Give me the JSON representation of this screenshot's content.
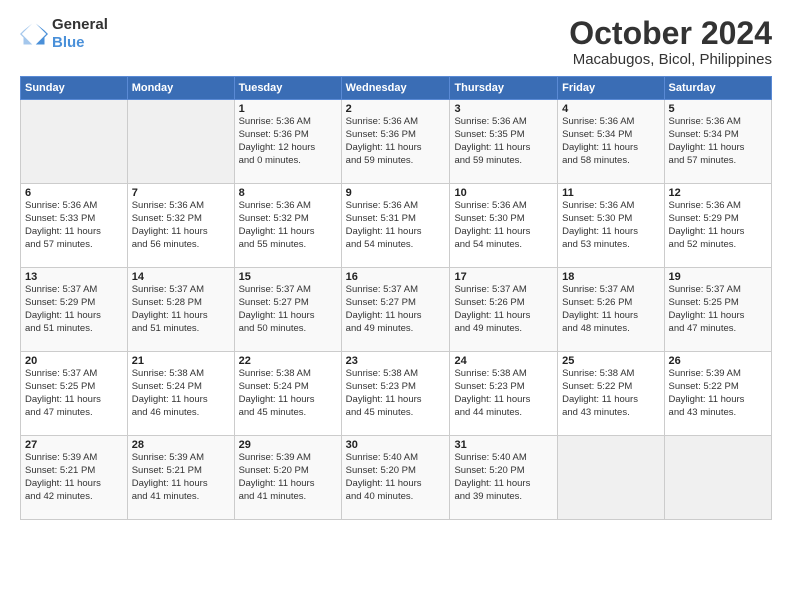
{
  "header": {
    "logo_line1": "General",
    "logo_line2": "Blue",
    "title": "October 2024",
    "subtitle": "Macabugos, Bicol, Philippines"
  },
  "weekdays": [
    "Sunday",
    "Monday",
    "Tuesday",
    "Wednesday",
    "Thursday",
    "Friday",
    "Saturday"
  ],
  "weeks": [
    [
      {
        "day": "",
        "info": ""
      },
      {
        "day": "",
        "info": ""
      },
      {
        "day": "1",
        "info": "Sunrise: 5:36 AM\nSunset: 5:36 PM\nDaylight: 12 hours\nand 0 minutes."
      },
      {
        "day": "2",
        "info": "Sunrise: 5:36 AM\nSunset: 5:36 PM\nDaylight: 11 hours\nand 59 minutes."
      },
      {
        "day": "3",
        "info": "Sunrise: 5:36 AM\nSunset: 5:35 PM\nDaylight: 11 hours\nand 59 minutes."
      },
      {
        "day": "4",
        "info": "Sunrise: 5:36 AM\nSunset: 5:34 PM\nDaylight: 11 hours\nand 58 minutes."
      },
      {
        "day": "5",
        "info": "Sunrise: 5:36 AM\nSunset: 5:34 PM\nDaylight: 11 hours\nand 57 minutes."
      }
    ],
    [
      {
        "day": "6",
        "info": "Sunrise: 5:36 AM\nSunset: 5:33 PM\nDaylight: 11 hours\nand 57 minutes."
      },
      {
        "day": "7",
        "info": "Sunrise: 5:36 AM\nSunset: 5:32 PM\nDaylight: 11 hours\nand 56 minutes."
      },
      {
        "day": "8",
        "info": "Sunrise: 5:36 AM\nSunset: 5:32 PM\nDaylight: 11 hours\nand 55 minutes."
      },
      {
        "day": "9",
        "info": "Sunrise: 5:36 AM\nSunset: 5:31 PM\nDaylight: 11 hours\nand 54 minutes."
      },
      {
        "day": "10",
        "info": "Sunrise: 5:36 AM\nSunset: 5:30 PM\nDaylight: 11 hours\nand 54 minutes."
      },
      {
        "day": "11",
        "info": "Sunrise: 5:36 AM\nSunset: 5:30 PM\nDaylight: 11 hours\nand 53 minutes."
      },
      {
        "day": "12",
        "info": "Sunrise: 5:36 AM\nSunset: 5:29 PM\nDaylight: 11 hours\nand 52 minutes."
      }
    ],
    [
      {
        "day": "13",
        "info": "Sunrise: 5:37 AM\nSunset: 5:29 PM\nDaylight: 11 hours\nand 51 minutes."
      },
      {
        "day": "14",
        "info": "Sunrise: 5:37 AM\nSunset: 5:28 PM\nDaylight: 11 hours\nand 51 minutes."
      },
      {
        "day": "15",
        "info": "Sunrise: 5:37 AM\nSunset: 5:27 PM\nDaylight: 11 hours\nand 50 minutes."
      },
      {
        "day": "16",
        "info": "Sunrise: 5:37 AM\nSunset: 5:27 PM\nDaylight: 11 hours\nand 49 minutes."
      },
      {
        "day": "17",
        "info": "Sunrise: 5:37 AM\nSunset: 5:26 PM\nDaylight: 11 hours\nand 49 minutes."
      },
      {
        "day": "18",
        "info": "Sunrise: 5:37 AM\nSunset: 5:26 PM\nDaylight: 11 hours\nand 48 minutes."
      },
      {
        "day": "19",
        "info": "Sunrise: 5:37 AM\nSunset: 5:25 PM\nDaylight: 11 hours\nand 47 minutes."
      }
    ],
    [
      {
        "day": "20",
        "info": "Sunrise: 5:37 AM\nSunset: 5:25 PM\nDaylight: 11 hours\nand 47 minutes."
      },
      {
        "day": "21",
        "info": "Sunrise: 5:38 AM\nSunset: 5:24 PM\nDaylight: 11 hours\nand 46 minutes."
      },
      {
        "day": "22",
        "info": "Sunrise: 5:38 AM\nSunset: 5:24 PM\nDaylight: 11 hours\nand 45 minutes."
      },
      {
        "day": "23",
        "info": "Sunrise: 5:38 AM\nSunset: 5:23 PM\nDaylight: 11 hours\nand 45 minutes."
      },
      {
        "day": "24",
        "info": "Sunrise: 5:38 AM\nSunset: 5:23 PM\nDaylight: 11 hours\nand 44 minutes."
      },
      {
        "day": "25",
        "info": "Sunrise: 5:38 AM\nSunset: 5:22 PM\nDaylight: 11 hours\nand 43 minutes."
      },
      {
        "day": "26",
        "info": "Sunrise: 5:39 AM\nSunset: 5:22 PM\nDaylight: 11 hours\nand 43 minutes."
      }
    ],
    [
      {
        "day": "27",
        "info": "Sunrise: 5:39 AM\nSunset: 5:21 PM\nDaylight: 11 hours\nand 42 minutes."
      },
      {
        "day": "28",
        "info": "Sunrise: 5:39 AM\nSunset: 5:21 PM\nDaylight: 11 hours\nand 41 minutes."
      },
      {
        "day": "29",
        "info": "Sunrise: 5:39 AM\nSunset: 5:20 PM\nDaylight: 11 hours\nand 41 minutes."
      },
      {
        "day": "30",
        "info": "Sunrise: 5:40 AM\nSunset: 5:20 PM\nDaylight: 11 hours\nand 40 minutes."
      },
      {
        "day": "31",
        "info": "Sunrise: 5:40 AM\nSunset: 5:20 PM\nDaylight: 11 hours\nand 39 minutes."
      },
      {
        "day": "",
        "info": ""
      },
      {
        "day": "",
        "info": ""
      }
    ]
  ]
}
